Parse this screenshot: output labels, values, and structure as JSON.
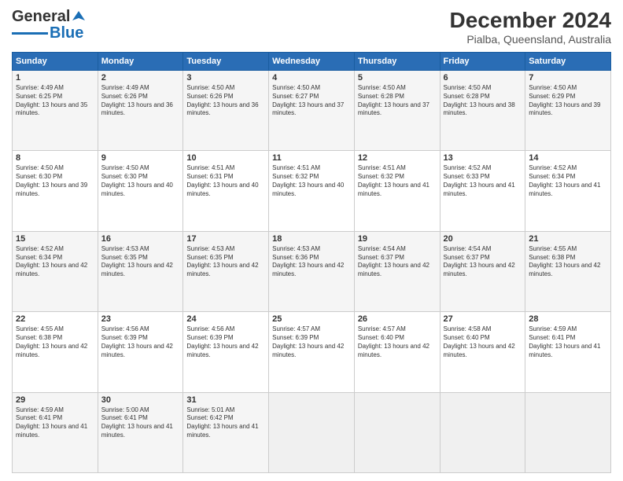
{
  "logo": {
    "line1": "General",
    "line2": "Blue"
  },
  "header": {
    "month": "December 2024",
    "location": "Pialba, Queensland, Australia"
  },
  "weekdays": [
    "Sunday",
    "Monday",
    "Tuesday",
    "Wednesday",
    "Thursday",
    "Friday",
    "Saturday"
  ],
  "weeks": [
    [
      {
        "day": "1",
        "sunrise": "4:49 AM",
        "sunset": "6:25 PM",
        "daylight": "13 hours and 35 minutes."
      },
      {
        "day": "2",
        "sunrise": "4:49 AM",
        "sunset": "6:26 PM",
        "daylight": "13 hours and 36 minutes."
      },
      {
        "day": "3",
        "sunrise": "4:50 AM",
        "sunset": "6:26 PM",
        "daylight": "13 hours and 36 minutes."
      },
      {
        "day": "4",
        "sunrise": "4:50 AM",
        "sunset": "6:27 PM",
        "daylight": "13 hours and 37 minutes."
      },
      {
        "day": "5",
        "sunrise": "4:50 AM",
        "sunset": "6:28 PM",
        "daylight": "13 hours and 37 minutes."
      },
      {
        "day": "6",
        "sunrise": "4:50 AM",
        "sunset": "6:28 PM",
        "daylight": "13 hours and 38 minutes."
      },
      {
        "day": "7",
        "sunrise": "4:50 AM",
        "sunset": "6:29 PM",
        "daylight": "13 hours and 39 minutes."
      }
    ],
    [
      {
        "day": "8",
        "sunrise": "4:50 AM",
        "sunset": "6:30 PM",
        "daylight": "13 hours and 39 minutes."
      },
      {
        "day": "9",
        "sunrise": "4:50 AM",
        "sunset": "6:30 PM",
        "daylight": "13 hours and 40 minutes."
      },
      {
        "day": "10",
        "sunrise": "4:51 AM",
        "sunset": "6:31 PM",
        "daylight": "13 hours and 40 minutes."
      },
      {
        "day": "11",
        "sunrise": "4:51 AM",
        "sunset": "6:32 PM",
        "daylight": "13 hours and 40 minutes."
      },
      {
        "day": "12",
        "sunrise": "4:51 AM",
        "sunset": "6:32 PM",
        "daylight": "13 hours and 41 minutes."
      },
      {
        "day": "13",
        "sunrise": "4:52 AM",
        "sunset": "6:33 PM",
        "daylight": "13 hours and 41 minutes."
      },
      {
        "day": "14",
        "sunrise": "4:52 AM",
        "sunset": "6:34 PM",
        "daylight": "13 hours and 41 minutes."
      }
    ],
    [
      {
        "day": "15",
        "sunrise": "4:52 AM",
        "sunset": "6:34 PM",
        "daylight": "13 hours and 42 minutes."
      },
      {
        "day": "16",
        "sunrise": "4:53 AM",
        "sunset": "6:35 PM",
        "daylight": "13 hours and 42 minutes."
      },
      {
        "day": "17",
        "sunrise": "4:53 AM",
        "sunset": "6:35 PM",
        "daylight": "13 hours and 42 minutes."
      },
      {
        "day": "18",
        "sunrise": "4:53 AM",
        "sunset": "6:36 PM",
        "daylight": "13 hours and 42 minutes."
      },
      {
        "day": "19",
        "sunrise": "4:54 AM",
        "sunset": "6:37 PM",
        "daylight": "13 hours and 42 minutes."
      },
      {
        "day": "20",
        "sunrise": "4:54 AM",
        "sunset": "6:37 PM",
        "daylight": "13 hours and 42 minutes."
      },
      {
        "day": "21",
        "sunrise": "4:55 AM",
        "sunset": "6:38 PM",
        "daylight": "13 hours and 42 minutes."
      }
    ],
    [
      {
        "day": "22",
        "sunrise": "4:55 AM",
        "sunset": "6:38 PM",
        "daylight": "13 hours and 42 minutes."
      },
      {
        "day": "23",
        "sunrise": "4:56 AM",
        "sunset": "6:39 PM",
        "daylight": "13 hours and 42 minutes."
      },
      {
        "day": "24",
        "sunrise": "4:56 AM",
        "sunset": "6:39 PM",
        "daylight": "13 hours and 42 minutes."
      },
      {
        "day": "25",
        "sunrise": "4:57 AM",
        "sunset": "6:39 PM",
        "daylight": "13 hours and 42 minutes."
      },
      {
        "day": "26",
        "sunrise": "4:57 AM",
        "sunset": "6:40 PM",
        "daylight": "13 hours and 42 minutes."
      },
      {
        "day": "27",
        "sunrise": "4:58 AM",
        "sunset": "6:40 PM",
        "daylight": "13 hours and 42 minutes."
      },
      {
        "day": "28",
        "sunrise": "4:59 AM",
        "sunset": "6:41 PM",
        "daylight": "13 hours and 41 minutes."
      }
    ],
    [
      {
        "day": "29",
        "sunrise": "4:59 AM",
        "sunset": "6:41 PM",
        "daylight": "13 hours and 41 minutes."
      },
      {
        "day": "30",
        "sunrise": "5:00 AM",
        "sunset": "6:41 PM",
        "daylight": "13 hours and 41 minutes."
      },
      {
        "day": "31",
        "sunrise": "5:01 AM",
        "sunset": "6:42 PM",
        "daylight": "13 hours and 41 minutes."
      },
      null,
      null,
      null,
      null
    ]
  ]
}
